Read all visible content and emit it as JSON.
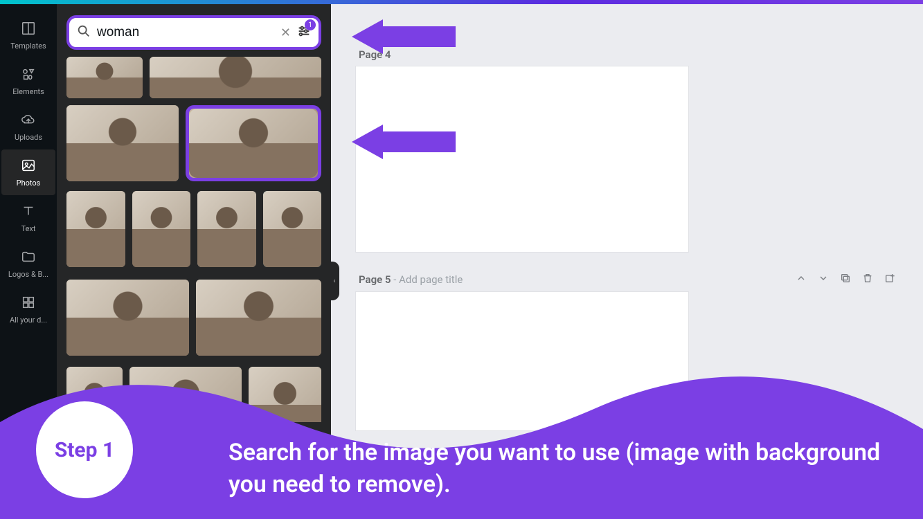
{
  "sidebar": {
    "items": [
      {
        "label": "Templates",
        "icon": "templates"
      },
      {
        "label": "Elements",
        "icon": "elements"
      },
      {
        "label": "Uploads",
        "icon": "uploads"
      },
      {
        "label": "Photos",
        "icon": "photos"
      },
      {
        "label": "Text",
        "icon": "text"
      },
      {
        "label": "Logos & B...",
        "icon": "folder"
      },
      {
        "label": "All your d...",
        "icon": "grid"
      }
    ],
    "active_index": 3
  },
  "search": {
    "value": "woman",
    "filter_badge": "1"
  },
  "photo_results": {
    "row1": [
      {
        "w": "30%"
      },
      {
        "w": "68%"
      }
    ],
    "row2": [
      {
        "w": "44%"
      },
      {
        "w": "54%",
        "selected": true
      }
    ],
    "row3": [
      {
        "w": "25%"
      },
      {
        "w": "23%"
      },
      {
        "w": "22%"
      },
      {
        "w": "22%"
      }
    ],
    "row4": [
      {
        "w": "48%"
      },
      {
        "w": "50%"
      }
    ],
    "row5": [
      {
        "w": "22%"
      },
      {
        "w": "44%"
      },
      {
        "w": "30%"
      }
    ]
  },
  "pages": {
    "page4": {
      "label": "Page 4"
    },
    "page5": {
      "label": "Page 5",
      "placeholder": "Add page title"
    }
  },
  "tutorial": {
    "step_label": "Step 1",
    "instruction": "Search for the image you want to use (image with background you need to remove)."
  },
  "colors": {
    "accent": "#7b3fe4"
  }
}
